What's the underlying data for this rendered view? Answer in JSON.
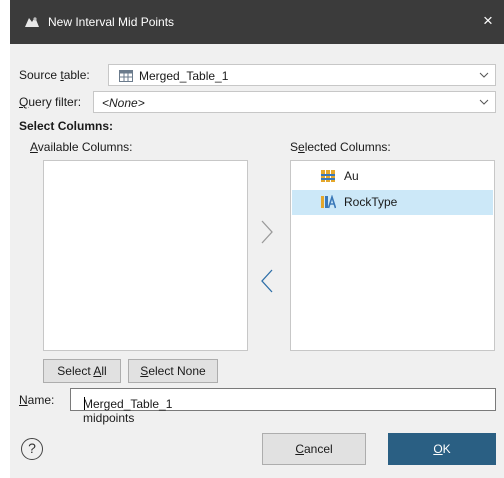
{
  "window": {
    "title": "New Interval Mid Points",
    "close_glyph": "×"
  },
  "source_table": {
    "label_pre": "Source ",
    "label_ul": "t",
    "label_post": "able:",
    "value": "Merged_Table_1",
    "icon": "table-icon"
  },
  "query_filter": {
    "label_ul": "Q",
    "label_post": "uery filter:",
    "value": "<None>"
  },
  "select_columns": {
    "heading": "Select Columns:",
    "available_label_ul": "A",
    "available_label_post": "vailable Columns:",
    "selected_label_pre": "S",
    "selected_label_ul": "e",
    "selected_label_post": "lected Columns:",
    "selected_items": [
      {
        "label": "Au",
        "icon": "numeric-column-icon"
      },
      {
        "label": "RockType",
        "icon": "category-column-icon"
      }
    ]
  },
  "buttons": {
    "select_all_pre": "Select ",
    "select_all_ul": "A",
    "select_all_post": "ll",
    "select_none_ul": "S",
    "select_none_post": "elect None",
    "cancel_ul": "C",
    "cancel_post": "ancel",
    "ok_ul": "O",
    "ok_post": "K",
    "help_glyph": "?"
  },
  "name": {
    "label_ul": "N",
    "label_post": "ame:",
    "value": "Merged_Table_1 midpoints"
  },
  "colors": {
    "titlebar": "#3b3b3b",
    "dialog_bg": "#f0f0f0",
    "selection": "#cce8f8",
    "primary": "#2a5f83"
  }
}
